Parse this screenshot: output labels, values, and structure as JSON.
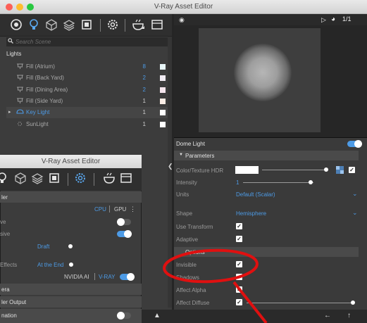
{
  "window": {
    "title": "V-Ray Asset Editor"
  },
  "toolbar": {
    "icons": [
      "materials-icon",
      "lights-icon",
      "geometry-icon",
      "textures-icon",
      "render-elements-icon",
      "settings-icon",
      "render-icon",
      "frame-buffer-icon"
    ]
  },
  "search": {
    "placeholder": "Search Scene"
  },
  "list": {
    "header": "Lights",
    "items": [
      {
        "label": "Fill (Atrium)",
        "count": "8",
        "count_color": "#4d9be6",
        "swatch": "#e8f6f8"
      },
      {
        "label": "Fill (Back Yard)",
        "count": "2",
        "count_color": "#4d9be6",
        "swatch": "#f2ecf4"
      },
      {
        "label": "Fill (Dining Area)",
        "count": "2",
        "count_color": "#4d9be6",
        "swatch": "#f6e6ee"
      },
      {
        "label": "Fill (Side Yard)",
        "count": "1",
        "count_color": "#cfcfcf",
        "swatch": "#fbeee6"
      },
      {
        "label": "Key Light",
        "count": "1",
        "count_color": "#cfcfcf",
        "swatch": "#ffffff"
      },
      {
        "label": "SunLight",
        "count": "1",
        "count_color": "#cfcfcf",
        "swatch": "#ffffff"
      }
    ]
  },
  "preview": {
    "page_num": "1/1"
  },
  "props": {
    "title": "Dome Light",
    "section": "Parameters",
    "color_texture_label": "Color/Texture HDR",
    "intensity_label": "Intensity",
    "intensity_value": "1",
    "units_label": "Units",
    "units_value": "Default (Scalar)",
    "shape_label": "Shape",
    "shape_value": "Hemisphere",
    "use_transform_label": "Use Transform",
    "adaptive_label": "Adaptive",
    "options_section": "Options",
    "invisible_label": "Invisible",
    "shadows_label": "Shadows",
    "affect_alpha_label": "Affect Alpha",
    "affect_diffuse_label": "Affect Diffuse"
  },
  "overlay": {
    "title": "V-Ray Asset Editor",
    "renderer_section": "ler",
    "cpu": "CPU",
    "gpu": "GPU",
    "row1": "ve",
    "row2": "sive",
    "quality": "Draft",
    "effects_label": "Effects",
    "effects_value": "At the End",
    "denoiser_nvidia": "NVIDIA AI",
    "denoiser_vray": "V-RAY",
    "camera_section": "era",
    "render_output_section": "ler Output",
    "animation_label": "nation"
  },
  "colors": {
    "accent": "#4d9be6",
    "annotation": "#e01010"
  }
}
